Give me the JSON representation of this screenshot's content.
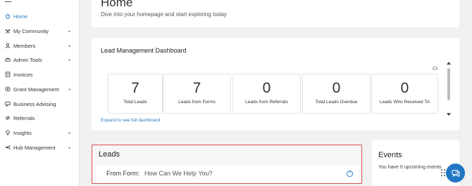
{
  "sidebar": {
    "items": [
      {
        "label": "Home",
        "icon": "home-icon",
        "has_submenu": false,
        "active": true
      },
      {
        "label": "My Community",
        "icon": "community-icon",
        "has_submenu": true
      },
      {
        "label": "Members",
        "icon": "user-icon",
        "has_submenu": true
      },
      {
        "label": "Admin Tools",
        "icon": "tools-icon",
        "has_submenu": true
      },
      {
        "label": "Invoices",
        "icon": "invoice-icon",
        "has_submenu": false
      },
      {
        "label": "Grant Management",
        "icon": "grant-icon",
        "has_submenu": true
      },
      {
        "label": "Business Advising",
        "icon": "advising-icon",
        "has_submenu": false
      },
      {
        "label": "Referrals",
        "icon": "referral-icon",
        "has_submenu": false
      },
      {
        "label": "Insights",
        "icon": "insights-icon",
        "has_submenu": true
      },
      {
        "label": "Hub Management",
        "icon": "hub-icon",
        "has_submenu": true
      }
    ]
  },
  "home": {
    "title": "Home",
    "subtitle": "Dive into your homepage and start exploring today"
  },
  "dashboard": {
    "title": "Lead Management Dashboard",
    "tiles": [
      {
        "value": "7",
        "label": "Total Leads"
      },
      {
        "value": "7",
        "label": "Leads from Forms"
      },
      {
        "value": "0",
        "label": "Leads from Referrals"
      },
      {
        "value": "0",
        "label": "Total Leads Overdue"
      },
      {
        "value": "0",
        "label": "Leads Who Received TA"
      }
    ],
    "expand_link": "Expand to see full dashboard"
  },
  "leads": {
    "title": "Leads",
    "form_label": "From Form:",
    "form_value": "How Can We Help You?"
  },
  "events": {
    "title": "Events",
    "text": "You have 0 upcoming events"
  },
  "colors": {
    "accent": "#2a7bc0",
    "chat_button": "#2176c4",
    "highlight_border": "#d9534f"
  }
}
